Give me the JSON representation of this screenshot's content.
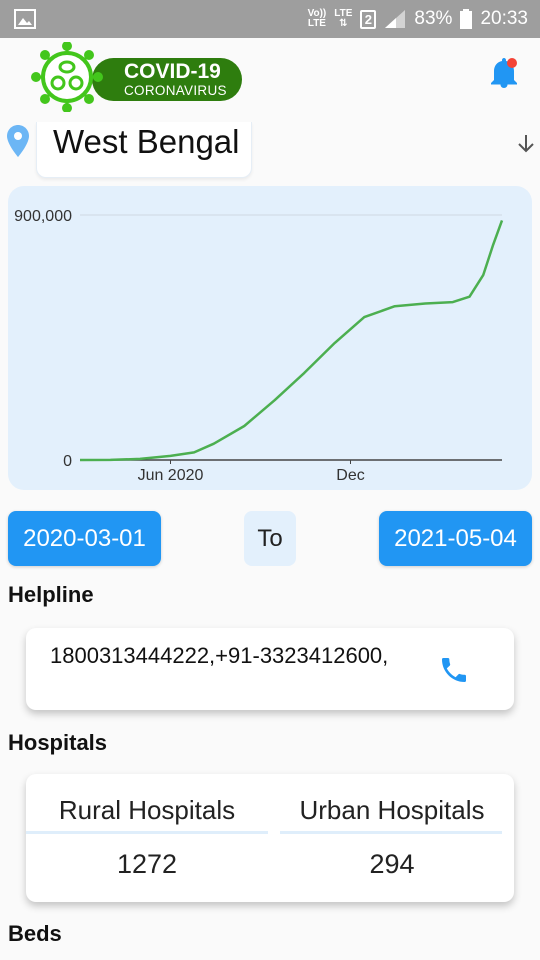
{
  "status_bar": {
    "network_label_top": "Vo))",
    "network_label_bottom": "LTE",
    "lte_label_top": "LTE",
    "lte_label_bottom": "⇅",
    "sim_slot": "2",
    "battery": "83%",
    "time": "20:33"
  },
  "header": {
    "logo_title": "COVID-19",
    "logo_subtitle": "CORONAVIRUS",
    "brand_color": "#2e7d0e",
    "notification_dot_color": "#f44336"
  },
  "location": {
    "state": "West Bengal",
    "icon": "location-pin-icon"
  },
  "chart_data": {
    "type": "line",
    "title": "",
    "xlabel": "",
    "ylabel": "",
    "x_tick_labels": [
      "Jun 2020",
      "Dec"
    ],
    "y_tick_labels": [
      "0",
      "900,000"
    ],
    "ylim": [
      0,
      900000
    ],
    "xlim": [
      "2020-03-01",
      "2021-05-04"
    ],
    "line_color": "#4caf50",
    "series": [
      {
        "x": [
          "2020-03-01",
          "2020-04-01",
          "2020-05-01",
          "2020-06-01",
          "2020-06-25",
          "2020-07-15",
          "2020-08-15",
          "2020-09-15",
          "2020-10-15",
          "2020-11-15",
          "2020-12-15",
          "2021-01-15",
          "2021-02-15",
          "2021-03-15",
          "2021-04-01",
          "2021-04-15",
          "2021-04-25",
          "2021-05-04"
        ],
        "y": [
          0,
          500,
          4000,
          15000,
          28000,
          60000,
          125000,
          220000,
          320000,
          430000,
          525000,
          565000,
          575000,
          580000,
          600000,
          680000,
          790000,
          880000
        ]
      }
    ]
  },
  "date_range": {
    "from": "2020-03-01",
    "separator": "To",
    "to": "2021-05-04"
  },
  "helpline": {
    "title": "Helpline",
    "number": "1800313444222,+91-3323412600,"
  },
  "hospitals": {
    "title": "Hospitals",
    "rural_label": "Rural Hospitals",
    "urban_label": "Urban Hospitals",
    "rural_value": "1272",
    "urban_value": "294"
  },
  "beds": {
    "title": "Beds"
  },
  "accent_color": "#2196f3"
}
